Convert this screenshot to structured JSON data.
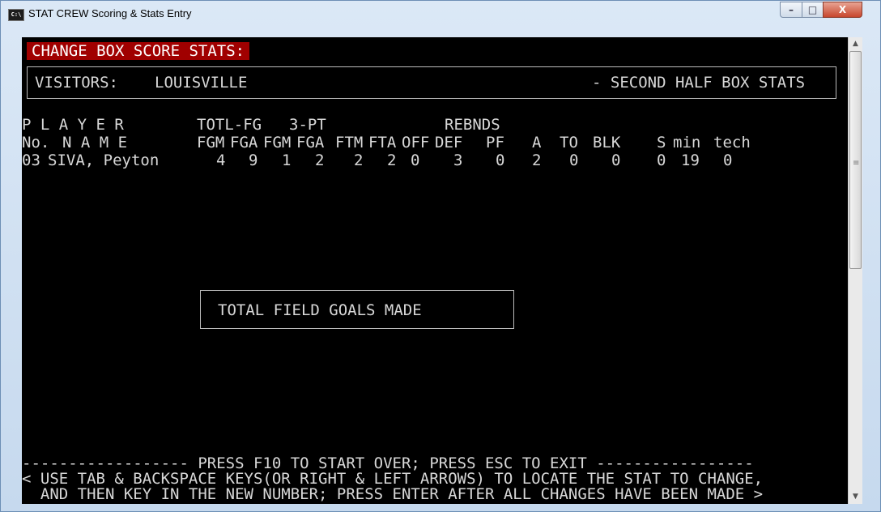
{
  "window": {
    "title": "STAT CREW Scoring & Stats Entry",
    "app_icon_text": "C:\\",
    "controls": {
      "minimize": "–",
      "maximize": "□",
      "close": "X"
    }
  },
  "console": {
    "header": "CHANGE BOX SCORE STATS:",
    "visitors_label": "VISITORS:",
    "team": "LOUISVILLE",
    "section": "- SECOND HALF BOX STATS",
    "col_header_row1": {
      "player": "P L A Y E R",
      "totl_fg": "TOTL-FG",
      "three_pt": "3-PT",
      "rebnds": "REBNDS"
    },
    "col_header_row2": {
      "no": "No.",
      "name": "N A M E",
      "fgm": "FGM",
      "fga": "FGA",
      "fgm3": "FGM",
      "fga3": "FGA",
      "ftm": "FTM",
      "fta": "FTA",
      "off": "OFF",
      "def": "DEF",
      "pf": "PF",
      "a": "A",
      "to": "TO",
      "blk": "BLK",
      "s": "S",
      "min": "min",
      "tech": "tech"
    },
    "player_row": {
      "no": "03",
      "name": "SIVA, Peyton",
      "fgm": "4",
      "fga": "9",
      "fgm3": "1",
      "fga3": "2",
      "ftm": "2",
      "fta": "2",
      "off": "0",
      "def": "3",
      "pf": "0",
      "a": "2",
      "to": "0",
      "blk": "0",
      "s": "0",
      "min": "19",
      "tech": "0"
    },
    "field_prompt": "TOTAL FIELD GOALS MADE",
    "footer_line1": "------------------ PRESS F10 TO START OVER; PRESS ESC TO EXIT -----------------",
    "footer_line2": "< USE TAB & BACKSPACE KEYS(OR RIGHT & LEFT ARROWS) TO LOCATE THE STAT TO CHANGE,",
    "footer_line3": "  AND THEN KEY IN THE NEW NUMBER; PRESS ENTER AFTER ALL CHANGES HAVE BEEN MADE >"
  },
  "scrollbar": {
    "up_arrow": "▲",
    "down_arrow": "▼",
    "grip": "≡"
  }
}
